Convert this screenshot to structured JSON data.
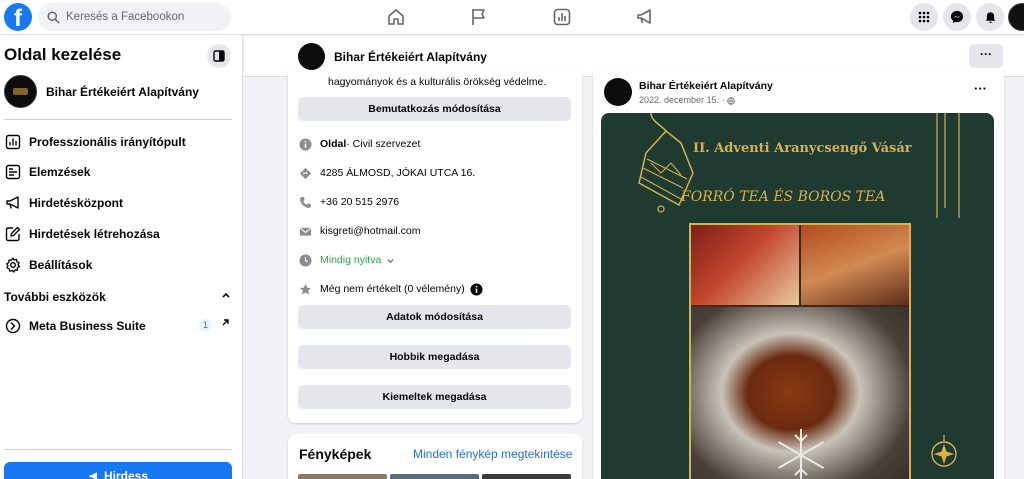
{
  "search": {
    "placeholder": "Keresés a Facebookon"
  },
  "sidebar": {
    "title": "Oldal kezelése",
    "page_name": "Bihar Értékeiért Alapítvány",
    "items": [
      {
        "label": "Professzionális irányítópult",
        "icon": "dashboard-icon"
      },
      {
        "label": "Elemzések",
        "icon": "insights-icon"
      },
      {
        "label": "Hirdetésközpont",
        "icon": "megaphone-icon"
      },
      {
        "label": "Hirdetések létrehozása",
        "icon": "edit-icon"
      },
      {
        "label": "Beállítások",
        "icon": "gear-icon"
      }
    ],
    "more_tools": "További eszközök",
    "meta_suite": {
      "label": "Meta Business Suite",
      "badge": "1"
    },
    "promote": "Hirdess"
  },
  "page_header": {
    "name": "Bihar Értékeiért Alapítvány",
    "more": "···"
  },
  "about": {
    "text": "hagyományok és a kulturális örökség védelme.",
    "edit_intro": "Bemutatkozás módosítása",
    "category_bold": "Oldal",
    "category_rest": " · Civil szervezet",
    "address": "4285 ÁLMOSD, JÓKAI UTCA 16.",
    "phone": "+36 20 515 2976",
    "email": "kisgreti@hotmail.com",
    "hours": "Mindig nyitva",
    "rating": "Még nem értékelt (0 vélemény)",
    "edit_details": "Adatok módosítása",
    "add_hobbies": "Hobbik megadása",
    "add_featured": "Kiemeltek megadása"
  },
  "photos": {
    "title": "Fényképek",
    "see_all": "Minden fénykép megtekintése"
  },
  "post": {
    "author": "Bihar Értékeiért Alapítvány",
    "date": "2022. december 15.",
    "more": "···",
    "poster_title": "II. Adventi Aranycsengő Vásár",
    "poster_subtitle": "FORRÓ TEA ÉS BOROS TEA"
  },
  "colors": {
    "brand": "#1877f2",
    "poster_bg": "#1f3a30",
    "gold": "#d9b04a",
    "open_green": "#31a24c"
  }
}
